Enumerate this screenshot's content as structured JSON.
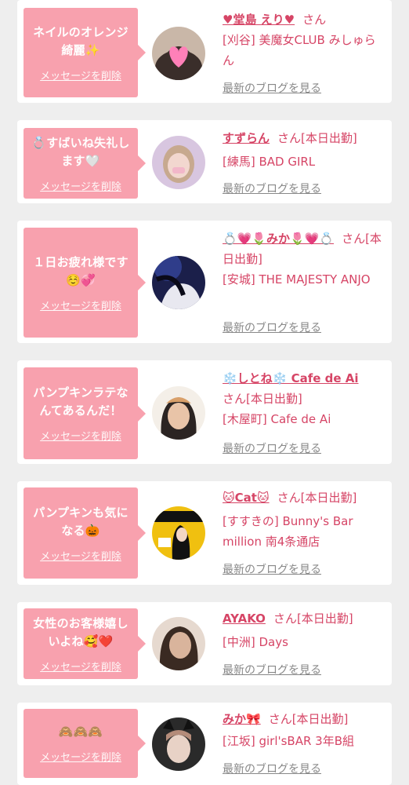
{
  "items": [
    {
      "message": "ネイルのオレンジ\n綺麗✨",
      "delete_label": "メッセージを削除",
      "name": "♥堂島 えり♥",
      "san_label": "さん",
      "status": "",
      "shop": "[刈谷] 美魔女CLUB みしゅらん",
      "blog_label": "最新のブログを見る",
      "avatar_colors": [
        "#c9b7a8",
        "#3a2e2a",
        "#ff80b8"
      ]
    },
    {
      "message": "💍すばいね失礼し\nます🤍",
      "delete_label": "メッセージを削除",
      "name": "すずらん",
      "san_label": "さん",
      "status": "[本日出勤]",
      "shop": "[練馬] BAD GIRL",
      "blog_label": "最新のブログを見る",
      "avatar_colors": [
        "#d8c6e0",
        "#c7a98f",
        "#f2b7c9"
      ]
    },
    {
      "message": "１日お疲れ様です\n☺️💞",
      "delete_label": "メッセージを削除",
      "name": "💍💗🌷みか🌷💗💍",
      "san_label": "さん",
      "status": "[本日出勤]",
      "shop": "[安城] THE MAJESTY ANJO",
      "blog_label": "最新のブログを見る",
      "avatar_colors": [
        "#1b1f4a",
        "#2f3d8a",
        "#e8e8f0"
      ]
    },
    {
      "message": "パンプキンラテな\nんてあるんだ！",
      "delete_label": "メッセージを削除",
      "name": "❄️しとね❄️ Cafe de Ai",
      "san_label": "さん",
      "status": "[本日出勤]",
      "shop": "[木屋町] Cafe de Ai",
      "blog_label": "最新のブログを見る",
      "avatar_colors": [
        "#f4efe8",
        "#2b2422",
        "#e9c4a8"
      ]
    },
    {
      "message": "パンプキンも気に\nなる🎃",
      "delete_label": "メッセージを削除",
      "name": "🐱Cat🐱",
      "san_label": "さん",
      "status": "[本日出勤]",
      "shop": "[すすきの] Bunny's Bar million 南4条通店",
      "blog_label": "最新のブログを見る",
      "avatar_colors": [
        "#f0c010",
        "#111111",
        "#ffffff"
      ]
    },
    {
      "message": "女性のお客様嬉し\nいよね🥰❤️",
      "delete_label": "メッセージを削除",
      "name": "AYAKO",
      "san_label": "さん",
      "status": "[本日出勤]",
      "shop": "[中洲] Days",
      "blog_label": "最新のブログを見る",
      "avatar_colors": [
        "#e6d9cf",
        "#3a2a22",
        "#d9b49c"
      ]
    },
    {
      "message": "🙈🙈🙈",
      "delete_label": "メッセージを削除",
      "name": "みか🎀",
      "san_label": "さん",
      "status": "[本日出勤]",
      "shop": "[江坂] girl'sBAR 3年B組",
      "blog_label": "最新のブログを見る",
      "avatar_colors": [
        "#2a2a2a",
        "#e8d2c6",
        "#b48c7a"
      ]
    }
  ]
}
